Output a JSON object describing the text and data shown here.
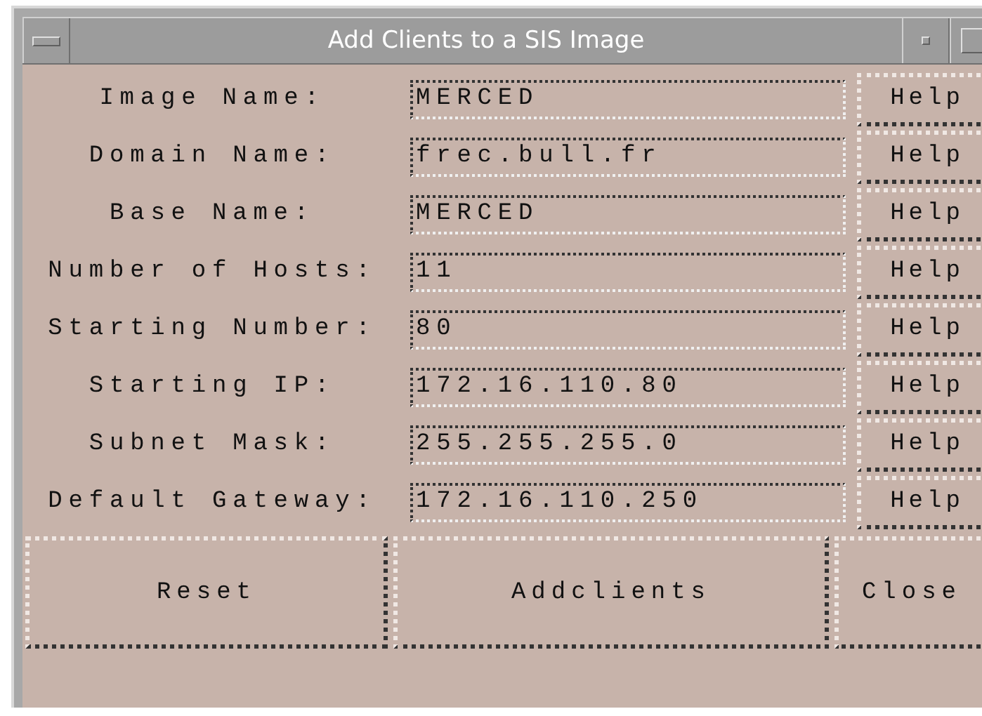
{
  "window": {
    "title": "Add Clients to a SIS Image"
  },
  "fields": [
    {
      "label": "Image Name:",
      "value": "MERCED",
      "help": "Help"
    },
    {
      "label": "Domain Name:",
      "value": "frec.bull.fr",
      "help": "Help"
    },
    {
      "label": "Base Name:",
      "value": "MERCED",
      "help": "Help"
    },
    {
      "label": "Number of Hosts:",
      "value": "11",
      "help": "Help"
    },
    {
      "label": "Starting Number:",
      "value": "80",
      "help": "Help"
    },
    {
      "label": "Starting IP:",
      "value": "172.16.110.80",
      "help": "Help"
    },
    {
      "label": "Subnet Mask:",
      "value": "255.255.255.0",
      "help": "Help"
    },
    {
      "label": "Default Gateway:",
      "value": "172.16.110.250",
      "help": "Help"
    }
  ],
  "buttons": [
    "Reset",
    "Addclients",
    "Close"
  ]
}
